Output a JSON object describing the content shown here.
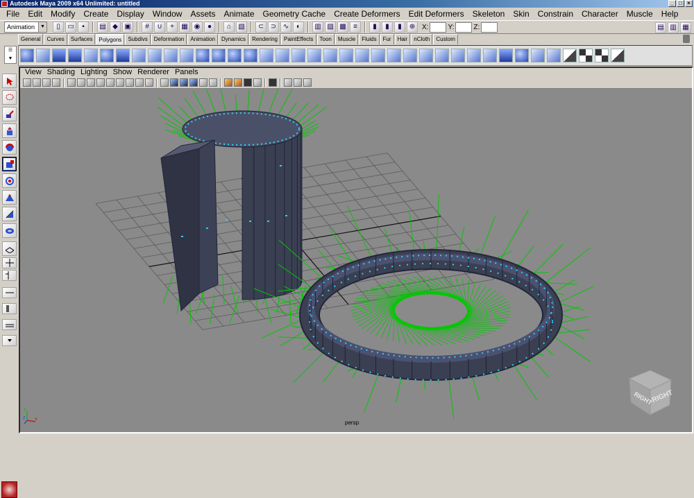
{
  "window": {
    "title": "Autodesk Maya 2009 x64 Unlimited: untitled",
    "controls": [
      "_",
      "□",
      "×"
    ]
  },
  "menubar": [
    "File",
    "Edit",
    "Modify",
    "Create",
    "Display",
    "Window",
    "Assets",
    "Animate",
    "Geometry Cache",
    "Create Deformers",
    "Edit Deformers",
    "Skeleton",
    "Skin",
    "Constrain",
    "Character",
    "Muscle",
    "Help"
  ],
  "statusline": {
    "menu_set": "Animation",
    "x_label": "X:",
    "y_label": "Y:",
    "z_label": "Z:",
    "x_value": "",
    "y_value": "",
    "z_value": ""
  },
  "shelf": {
    "tabs": [
      "General",
      "Curves",
      "Surfaces",
      "Polygons",
      "Subdivs",
      "Deformation",
      "Animation",
      "Dynamics",
      "Rendering",
      "PaintEffects",
      "Toon",
      "Muscle",
      "Fluids",
      "Fur",
      "Hair",
      "nCloth",
      "Custom"
    ],
    "active_tab": "Polygons",
    "icons": [
      "poly-sphere-icon",
      "poly-cube-icon",
      "poly-cylinder-icon",
      "poly-cone-icon",
      "poly-plane-icon",
      "poly-torus-icon",
      "poly-pyramid-icon",
      "poly-pipe-icon",
      "combine-icon",
      "separate-icon",
      "extract-icon",
      "smooth-icon",
      "boolean-union-icon",
      "boolean-difference-icon",
      "boolean-intersection-icon",
      "mirror-icon",
      "bridge-icon",
      "append-icon",
      "split-icon",
      "insert-edge-loop-icon",
      "extrude-icon",
      "bevel-icon",
      "merge-icon",
      "collapse-icon",
      "delete-edge-icon",
      "cut-faces-icon",
      "wedge-icon",
      "poke-icon",
      "chamfer-icon",
      "planar-map-icon",
      "cylindrical-map-icon",
      "spherical-map-icon",
      "auto-map-icon",
      "uv-texture-editor-icon",
      "checker-icon",
      "checker-2-icon",
      "checker-3-icon",
      "checker-4-icon"
    ]
  },
  "panel": {
    "menus": [
      "View",
      "Shading",
      "Lighting",
      "Show",
      "Renderer",
      "Panels"
    ],
    "camera": "persp",
    "viewcube_faces": [
      "RIGHT",
      "RIGHT"
    ]
  },
  "colors": {
    "viewport_bg": "#8a8a8a",
    "normals": "#00c800",
    "mesh": "#3a3f52",
    "vertex": "#34d0f0",
    "grid": "#5a5a5a"
  }
}
